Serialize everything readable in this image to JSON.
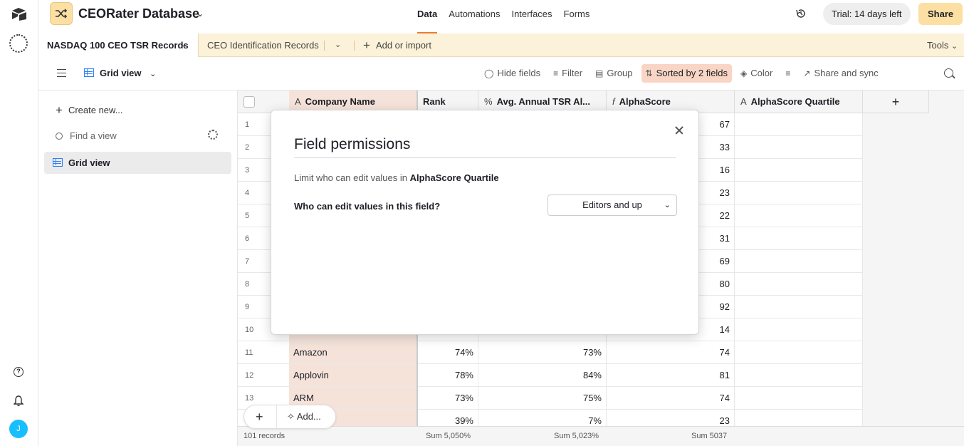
{
  "header": {
    "base_name": "CEORater Database",
    "nav": [
      "Data",
      "Automations",
      "Interfaces",
      "Forms"
    ],
    "trial": "Trial: 14 days left",
    "share": "Share"
  },
  "tables": {
    "active": "NASDAQ 100 CEO TSR Records",
    "second": "CEO Identification Records",
    "add_import": "Add or import",
    "tools": "Tools"
  },
  "viewbar": {
    "view_name": "Grid view",
    "hide_fields": "Hide fields",
    "filter": "Filter",
    "group": "Group",
    "sorted": "Sorted by 2 fields",
    "color": "Color",
    "share_sync": "Share and sync"
  },
  "sidebar": {
    "create": "Create new...",
    "find_placeholder": "Find a view",
    "view_item": "Grid view"
  },
  "grid": {
    "headers": {
      "company": "Company Name",
      "rank": "Rank",
      "tsr": "Avg. Annual TSR Al...",
      "alphascore": "AlphaScore",
      "quartile": "AlphaScore Quartile"
    },
    "rows": [
      {
        "n": "1",
        "company": "",
        "rank": "",
        "tsr": "",
        "score": "67"
      },
      {
        "n": "2",
        "company": "",
        "rank": "",
        "tsr": "",
        "score": "33"
      },
      {
        "n": "3",
        "company": "",
        "rank": "",
        "tsr": "",
        "score": "16"
      },
      {
        "n": "4",
        "company": "",
        "rank": "",
        "tsr": "",
        "score": "23"
      },
      {
        "n": "5",
        "company": "",
        "rank": "",
        "tsr": "",
        "score": "22"
      },
      {
        "n": "6",
        "company": "",
        "rank": "",
        "tsr": "",
        "score": "31"
      },
      {
        "n": "7",
        "company": "",
        "rank": "",
        "tsr": "",
        "score": "69"
      },
      {
        "n": "8",
        "company": "",
        "rank": "",
        "tsr": "",
        "score": "80"
      },
      {
        "n": "9",
        "company": "",
        "rank": "",
        "tsr": "",
        "score": "92"
      },
      {
        "n": "10",
        "company": "",
        "rank": "",
        "tsr": "",
        "score": "14"
      },
      {
        "n": "11",
        "company": "Amazon",
        "rank": "74%",
        "tsr": "73%",
        "score": "74"
      },
      {
        "n": "12",
        "company": "Applovin",
        "rank": "78%",
        "tsr": "84%",
        "score": "81"
      },
      {
        "n": "13",
        "company": "ARM",
        "rank": "73%",
        "tsr": "75%",
        "score": "74"
      },
      {
        "n": "",
        "company": "",
        "rank": "39%",
        "tsr": "7%",
        "score": "23"
      }
    ],
    "footer": {
      "records": "101 records",
      "sum_rank": "Sum 5,050%",
      "sum_tsr": "Sum 5,023%",
      "sum_score": "Sum 5037"
    },
    "add_label": "Add..."
  },
  "modal": {
    "title": "Field permissions",
    "desc_prefix": "Limit who can edit values in ",
    "desc_field": "AlphaScore Quartile",
    "question": "Who can edit values in this field?",
    "select_value": "Editors and up"
  }
}
